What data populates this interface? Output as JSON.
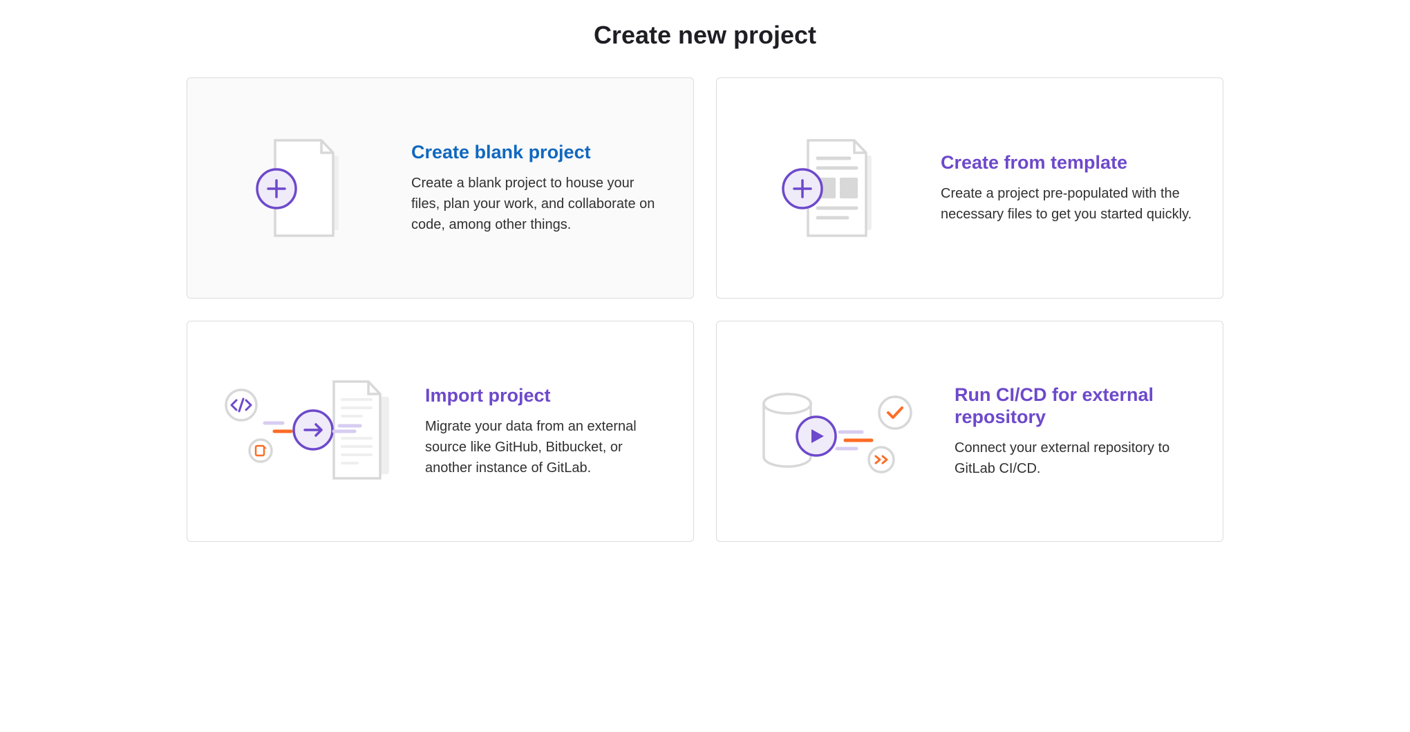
{
  "page": {
    "title": "Create new project"
  },
  "cards": [
    {
      "title": "Create blank project",
      "description": "Create a blank project to house your files, plan your work, and collaborate on code, among other things."
    },
    {
      "title": "Create from template",
      "description": "Create a project pre-populated with the necessary files to get you started quickly."
    },
    {
      "title": "Import project",
      "description": "Migrate your data from an external source like GitHub, Bitbucket, or another instance of GitLab."
    },
    {
      "title": "Run CI/CD for external repository",
      "description": "Connect your external repository to GitLab CI/CD."
    }
  ]
}
